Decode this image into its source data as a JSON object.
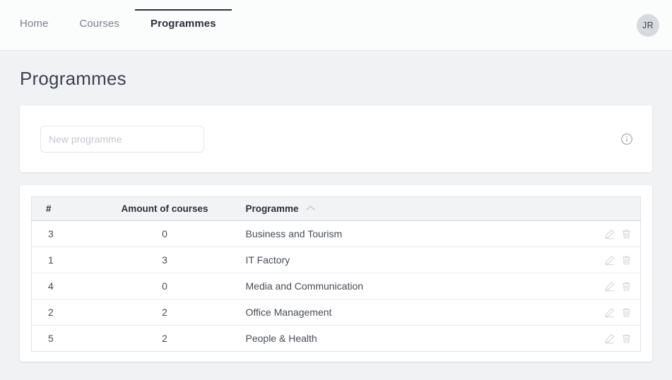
{
  "nav": {
    "items": [
      {
        "label": "Home",
        "active": false
      },
      {
        "label": "Courses",
        "active": false
      },
      {
        "label": "Programmes",
        "active": true
      }
    ],
    "avatar_initials": "JR"
  },
  "page": {
    "title": "Programmes"
  },
  "new_programme": {
    "placeholder": "New programme",
    "value": "",
    "info_icon": "info-circle-icon"
  },
  "table": {
    "columns": [
      {
        "key": "num",
        "label": "#",
        "sorted": false
      },
      {
        "key": "count",
        "label": "Amount of courses",
        "sorted": false
      },
      {
        "key": "name",
        "label": "Programme",
        "sorted": true,
        "sort_direction": "asc",
        "sort_icon": "chevron-up-icon"
      },
      {
        "key": "actions",
        "label": "",
        "sorted": false
      }
    ],
    "rows": [
      {
        "num": "3",
        "count": "0",
        "name": "Business and Tourism"
      },
      {
        "num": "1",
        "count": "3",
        "name": "IT Factory"
      },
      {
        "num": "4",
        "count": "0",
        "name": "Media and Communication"
      },
      {
        "num": "2",
        "count": "2",
        "name": "Office Management"
      },
      {
        "num": "5",
        "count": "2",
        "name": "People & Health"
      }
    ],
    "row_actions": [
      {
        "name": "edit-icon",
        "title": "Edit"
      },
      {
        "name": "delete-icon",
        "title": "Delete"
      }
    ]
  },
  "colors": {
    "page_background": "#f0f2f4",
    "header_background": "#fbfcfc",
    "card_background": "#ffffff",
    "text_primary": "#3a4049",
    "text_muted": "#7b818b",
    "table_header_background": "#f1f3f5",
    "avatar_background": "#d7dade"
  }
}
